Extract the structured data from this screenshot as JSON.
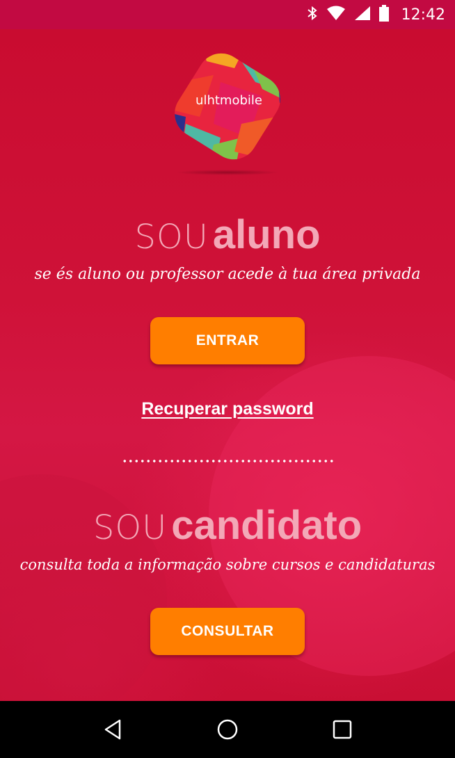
{
  "status_bar": {
    "time": "12:42",
    "icons": [
      "bluetooth-icon",
      "wifi-icon",
      "cellular-signal-icon",
      "battery-icon"
    ]
  },
  "logo": {
    "text": "ulhtmobile",
    "colors": [
      "#e8243f",
      "#f5a623",
      "#2b2f8c",
      "#7fc24a",
      "#4fb8a4"
    ]
  },
  "student": {
    "heading_light": "SOU",
    "heading_bold": "aluno",
    "subtitle": "se és aluno ou professor acede à tua área privada",
    "button_label": "ENTRAR",
    "recover_link": "Recuperar password"
  },
  "candidate": {
    "heading_light": "SOU",
    "heading_bold": "candidato",
    "subtitle": "consulta toda a informação sobre cursos e candidaturas",
    "button_label": "CONSULTAR"
  },
  "nav_bar": {
    "icons": [
      "back-icon",
      "home-icon",
      "recents-icon"
    ]
  },
  "colors": {
    "accent": "#ff7e00",
    "background": "#c40f3a",
    "heading": "#f3a8b7"
  }
}
